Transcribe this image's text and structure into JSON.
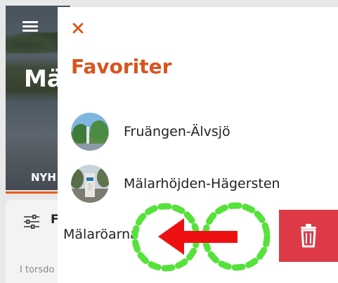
{
  "background": {
    "title_partial": "Mä",
    "tab_partial": "NYH",
    "filter_partial": "F",
    "note_partial": "I torsdo"
  },
  "drawer": {
    "title": "Favoriter",
    "favorites": [
      {
        "label": "Fruängen-Älvsjö"
      },
      {
        "label": "Mälarhöjden-Hägersten"
      }
    ],
    "swiped_item": {
      "label": "Mälaröarna"
    }
  },
  "colors": {
    "accent": "#d9541e",
    "delete": "#dd3a45",
    "gesture_circles": "#55e23a",
    "gesture_arrow": "#ee1111"
  },
  "icons": {
    "menu": "hamburger-icon",
    "close": "close-icon",
    "filter": "filter-icon",
    "delete": "trash-icon"
  }
}
